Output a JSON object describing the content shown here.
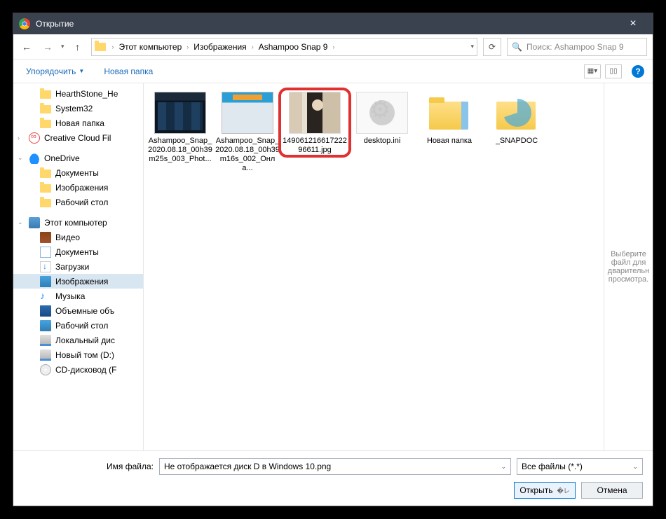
{
  "title": "Открытие",
  "breadcrumbs": [
    "Этот компьютер",
    "Изображения",
    "Ashampoo Snap 9"
  ],
  "search_placeholder": "Поиск: Ashampoo Snap 9",
  "toolbar": {
    "organize": "Упорядочить",
    "new_folder": "Новая папка"
  },
  "sidebar": {
    "g1": [
      {
        "label": "HearthStone_He",
        "icon": "folder"
      },
      {
        "label": "System32",
        "icon": "folder"
      },
      {
        "label": "Новая папка",
        "icon": "folder"
      }
    ],
    "cc": "Creative Cloud Fil",
    "onedrive": "OneDrive",
    "od_children": [
      {
        "label": "Документы",
        "icon": "folder"
      },
      {
        "label": "Изображения",
        "icon": "folder"
      },
      {
        "label": "Рабочий стол",
        "icon": "folder"
      }
    ],
    "pc": "Этот компьютер",
    "pc_children": [
      {
        "label": "Видео",
        "icon": "video"
      },
      {
        "label": "Документы",
        "icon": "doc"
      },
      {
        "label": "Загрузки",
        "icon": "down"
      },
      {
        "label": "Изображения",
        "icon": "img",
        "selected": true
      },
      {
        "label": "Музыка",
        "icon": "music"
      },
      {
        "label": "Объемные объ",
        "icon": "3d"
      },
      {
        "label": "Рабочий стол",
        "icon": "desk"
      },
      {
        "label": "Локальный дис",
        "icon": "disk"
      },
      {
        "label": "Новый том (D:)",
        "icon": "disk"
      },
      {
        "label": "CD-дисковод (F",
        "icon": "cd"
      }
    ]
  },
  "files": [
    {
      "label": "Ashampoo_Snap_2020.08.18_00h39m25s_003_Phot...",
      "thumb": "screenshot"
    },
    {
      "label": "Ashampoo_Snap_2020.08.18_00h39m16s_002_Онла...",
      "thumb": "screenshot2"
    },
    {
      "label": "14906121661722296611.jpg",
      "thumb": "photo",
      "highlight": true
    },
    {
      "label": "desktop.ini",
      "thumb": "ini"
    },
    {
      "label": "Новая папка",
      "thumb": "folder-peek"
    },
    {
      "label": "_SNAPDOC",
      "thumb": "snapdoc"
    }
  ],
  "preview_text": "Выберите файл для дварительн просмотра.",
  "filename_label": "Имя файла:",
  "filename_value": "Не отображается диск D в Windows 10.png",
  "filter_value": "Все файлы (*.*)",
  "open_label": "Открыть",
  "cancel_label": "Отмена",
  "help": "?"
}
